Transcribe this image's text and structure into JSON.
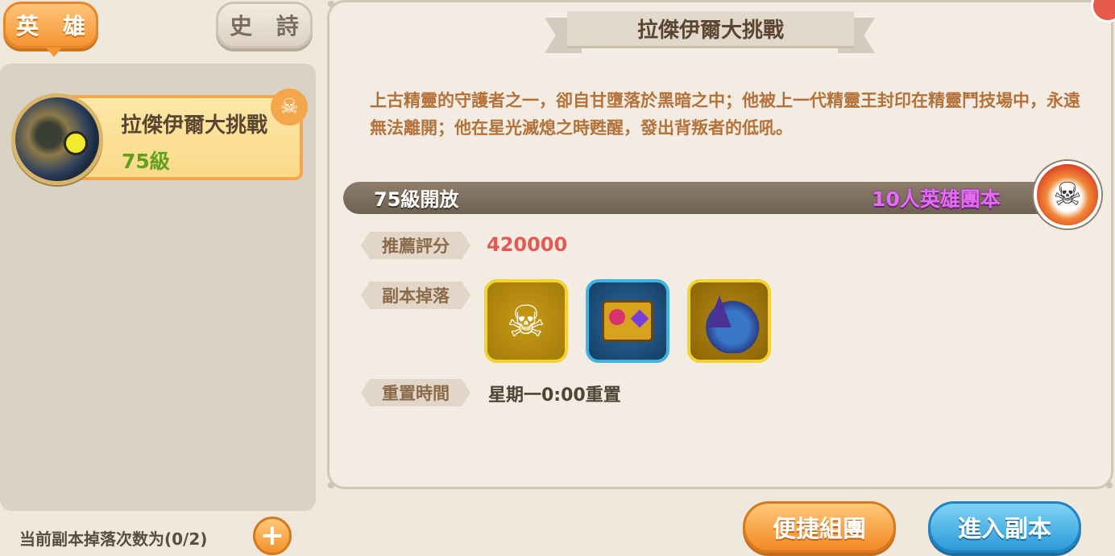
{
  "tabs": {
    "hero": "英 雄",
    "epic": "史 詩"
  },
  "dungeon_list": [
    {
      "title": "拉傑伊爾大挑戰",
      "level": "75級"
    }
  ],
  "footer": {
    "drop_count": "当前副本掉落次数为(0/2)",
    "plus": "+"
  },
  "detail": {
    "title": "拉傑伊爾大挑戰",
    "description": "上古精靈的守護者之一，卻自甘墮落於黑暗之中；他被上一代精靈王封印在精靈鬥技場中，永遠無法離開；他在星光滅熄之時甦醒，發出背叛者的低吼。",
    "open_level": "75級開放",
    "raid_type": "10人英雄團本",
    "recommended_label": "推薦評分",
    "recommended_score": "420000",
    "drops_label": "副本掉落",
    "drops": [
      "skull-icon",
      "treasure-chest-icon",
      "dragon-icon"
    ],
    "reset_label": "重置時間",
    "reset_value": "星期一0:00重置"
  },
  "buttons": {
    "quick_team": "便捷組團",
    "enter": "進入副本"
  },
  "colors": {
    "accent_orange": "#f59534",
    "accent_blue": "#2c9ad8",
    "score_red": "#e35a54",
    "raid_purple": "#e86bf4",
    "level_green": "#5fa01e",
    "desc_brown": "#b47139"
  }
}
